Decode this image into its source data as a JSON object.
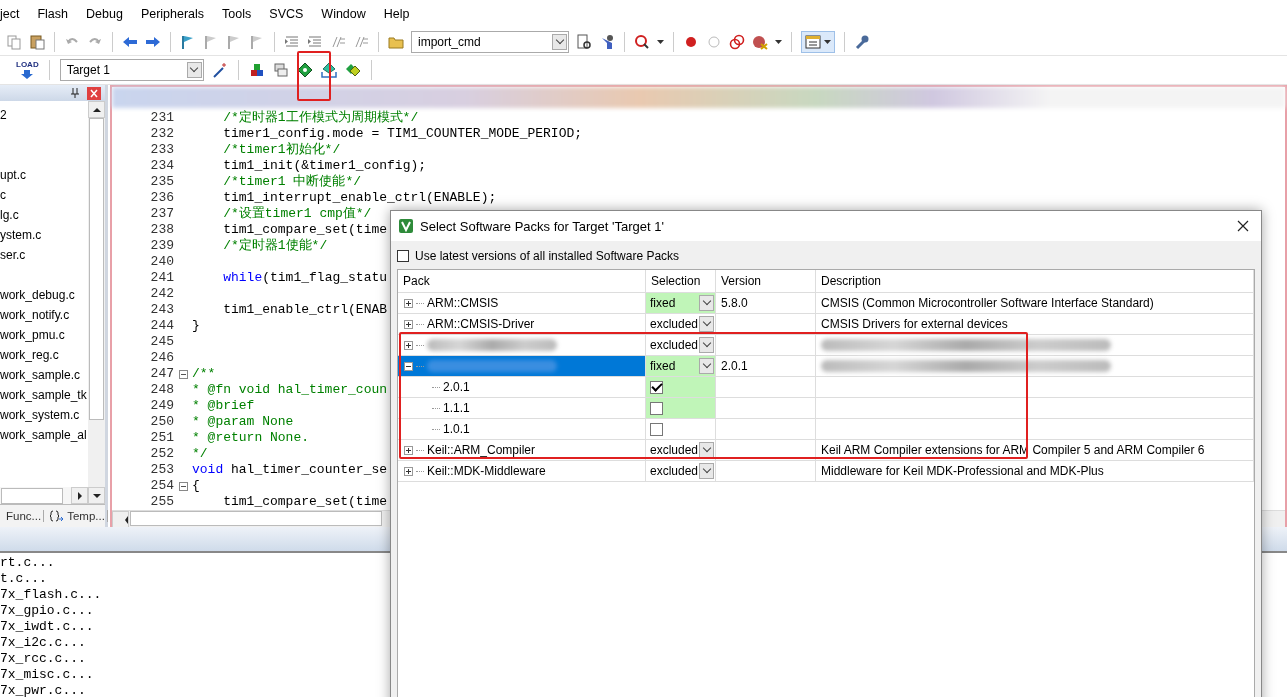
{
  "menu": [
    "ject",
    "Flash",
    "Debug",
    "Peripherals",
    "Tools",
    "SVCS",
    "Window",
    "Help"
  ],
  "toolbar": {
    "command_box": "import_cmd",
    "load_label": "LOAD",
    "target": "Target 1"
  },
  "project_panel": {
    "items": [
      {
        "kind": "file",
        "label": "2"
      },
      {
        "kind": "blank"
      },
      {
        "kind": "blank"
      },
      {
        "kind": "file",
        "label": "upt.c"
      },
      {
        "kind": "file",
        "label": "c"
      },
      {
        "kind": "file",
        "label": "lg.c"
      },
      {
        "kind": "file",
        "label": "ystem.c"
      },
      {
        "kind": "file",
        "label": "ser.c"
      },
      {
        "kind": "blank"
      },
      {
        "kind": "file",
        "label": "work_debug.c"
      },
      {
        "kind": "file",
        "label": "work_notify.c"
      },
      {
        "kind": "file",
        "label": "work_pmu.c"
      },
      {
        "kind": "file",
        "label": "work_reg.c"
      },
      {
        "kind": "file",
        "label": "work_sample.c"
      },
      {
        "kind": "file",
        "label": "work_sample_tk"
      },
      {
        "kind": "file",
        "label": "work_system.c"
      },
      {
        "kind": "file",
        "label": "work_sample_al"
      }
    ],
    "tabs": [
      "Func...",
      "Temp..."
    ]
  },
  "editor": {
    "lines": [
      {
        "number": "231",
        "fold": false,
        "segments": [
          {
            "kind": "comment",
            "text": "    /*定时器1工作模式为周期模式*/"
          }
        ]
      },
      {
        "number": "232",
        "fold": false,
        "segments": [
          {
            "kind": "code",
            "text": "    timer1_config.mode = TIM1_COUNTER_MODE_PERIOD;"
          }
        ]
      },
      {
        "number": "233",
        "fold": false,
        "segments": [
          {
            "kind": "comment",
            "text": "    /*timer1初始化*/"
          }
        ]
      },
      {
        "number": "234",
        "fold": false,
        "segments": [
          {
            "kind": "code",
            "text": "    tim1_init(&timer1_config);"
          }
        ]
      },
      {
        "number": "235",
        "fold": false,
        "segments": [
          {
            "kind": "comment",
            "text": "    /*timer1 中断使能*/"
          }
        ]
      },
      {
        "number": "236",
        "fold": false,
        "segments": [
          {
            "kind": "code",
            "text": "    tim1_interrupt_enable_ctrl(ENABLE);"
          }
        ]
      },
      {
        "number": "237",
        "fold": false,
        "segments": [
          {
            "kind": "comment",
            "text": "    /*设置timer1 cmp值*/"
          }
        ]
      },
      {
        "number": "238",
        "fold": false,
        "segments": [
          {
            "kind": "code",
            "text": "    tim1_compare_set(time"
          }
        ]
      },
      {
        "number": "239",
        "fold": false,
        "segments": [
          {
            "kind": "comment",
            "text": "    /*定时器1使能*/"
          }
        ]
      },
      {
        "number": "240",
        "fold": false
      },
      {
        "number": "241",
        "fold": false,
        "segments": [
          {
            "kind": "keyword",
            "text": "    while"
          },
          {
            "kind": "code",
            "text": "(tim1_flag_statu"
          }
        ]
      },
      {
        "number": "242",
        "fold": false
      },
      {
        "number": "243",
        "fold": false,
        "segments": [
          {
            "kind": "code",
            "text": "    tim1_enable_ctrl(ENAB"
          }
        ]
      },
      {
        "number": "244",
        "fold": false,
        "segments": [
          {
            "kind": "code",
            "text": "}"
          }
        ]
      },
      {
        "number": "245",
        "fold": false
      },
      {
        "number": "246",
        "fold": false
      },
      {
        "number": "247",
        "fold": true,
        "segments": [
          {
            "kind": "comment",
            "text": "/**"
          }
        ]
      },
      {
        "number": "248",
        "fold": false,
        "segments": [
          {
            "kind": "comment",
            "text": "* @fn void hal_timer_coun"
          }
        ]
      },
      {
        "number": "249",
        "fold": false,
        "segments": [
          {
            "kind": "comment",
            "text": "* @brief"
          }
        ]
      },
      {
        "number": "250",
        "fold": false,
        "segments": [
          {
            "kind": "comment",
            "text": "* @param None"
          }
        ]
      },
      {
        "number": "251",
        "fold": false,
        "segments": [
          {
            "kind": "comment",
            "text": "* @return None."
          }
        ]
      },
      {
        "number": "252",
        "fold": false,
        "segments": [
          {
            "kind": "comment",
            "text": "*/"
          }
        ]
      },
      {
        "number": "253",
        "fold": false,
        "segments": [
          {
            "kind": "keyword",
            "text": "void"
          },
          {
            "kind": "code",
            "text": " hal_timer_counter_se"
          }
        ]
      },
      {
        "number": "254",
        "fold": true,
        "segments": [
          {
            "kind": "code",
            "text": "{"
          }
        ]
      },
      {
        "number": "255",
        "fold": false,
        "segments": [
          {
            "kind": "code",
            "text": "    tim1_compare_set(time"
          }
        ]
      }
    ]
  },
  "output": {
    "lines": [
      "rt.c...",
      "t.c...",
      "7x_flash.c...",
      "7x_gpio.c...",
      "7x_iwdt.c...",
      "7x_i2c.c...",
      "7x_rcc.c...",
      "7x_misc.c...",
      "7x_pwr.c..."
    ]
  },
  "dialog": {
    "title": "Select Software Packs for Target 'Target 1'",
    "use_latest": {
      "label": "Use latest versions of all installed Software Packs",
      "checked": false
    },
    "columns": [
      "Pack",
      "Selection",
      "Version",
      "Description"
    ],
    "rows": [
      {
        "name": "ARM::CMSIS",
        "redacted": false,
        "expanded": false,
        "selected": false,
        "selection": "fixed",
        "highlighted": true,
        "version": "5.8.0",
        "description": "CMSIS (Common Microcontroller Software Interface Standard)"
      },
      {
        "name": "ARM::CMSIS-Driver",
        "redacted": false,
        "expanded": false,
        "selected": false,
        "selection": "excluded",
        "highlighted": false,
        "description": "CMSIS Drivers for external devices"
      },
      {
        "redacted": true,
        "expanded": false,
        "selected": false,
        "selection": "excluded",
        "highlighted": false
      },
      {
        "redacted": true,
        "expanded": true,
        "selected": true,
        "selection": "fixed",
        "highlighted": true,
        "version": "2.0.1",
        "children": [
          {
            "name": "2.0.1",
            "checked": true,
            "highlighted": true
          },
          {
            "name": "1.1.1",
            "checked": false,
            "highlighted": true
          },
          {
            "name": "1.0.1",
            "checked": false,
            "highlighted": false
          }
        ]
      },
      {
        "name": "Keil::ARM_Compiler",
        "redacted": false,
        "expanded": false,
        "selected": false,
        "selection": "excluded",
        "highlighted": false,
        "description": "Keil ARM Compiler extensions for ARM Compiler 5 and ARM Compiler 6"
      },
      {
        "name": "Keil::MDK-Middleware",
        "redacted": false,
        "expanded": false,
        "selected": false,
        "selection": "excluded",
        "highlighted": false,
        "description": "Middleware for Keil MDK-Professional and MDK-Plus"
      }
    ]
  }
}
